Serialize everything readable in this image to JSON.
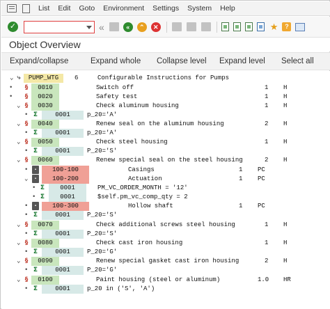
{
  "menu": {
    "items": [
      "List",
      "Edit",
      "Goto",
      "Environment",
      "Settings",
      "System",
      "Help"
    ]
  },
  "toolbar": {
    "command_field_value": ""
  },
  "title": "Object Overview",
  "app_toolbar": {
    "expand_collapse": "Expand/collapse",
    "expand_whole": "Expand whole",
    "collapse_level": "Collapse level",
    "expand_level": "Expand level",
    "select_all": "Select all"
  },
  "colors": {
    "green_cell": "#c9e6bd",
    "teal_cell": "#d7e9e7",
    "red_cell": "#f0a096",
    "root_cell": "#f4e8a6"
  },
  "tree": {
    "root": {
      "code": "PUMP_WTG",
      "number": "6",
      "description": "Configurable Instructions for Pumps"
    },
    "rows": [
      {
        "code": "0010",
        "text": "Switch off",
        "qty": "1",
        "unit": "H"
      },
      {
        "code": "0020",
        "text": "Safety test",
        "qty": "1",
        "unit": "H"
      },
      {
        "code": "0030",
        "text": "Check aluminum housing",
        "qty": "1",
        "unit": "H"
      },
      {
        "code": "0001",
        "text": "p_20='A'",
        "qty": "",
        "unit": ""
      },
      {
        "code": "0040",
        "text": "Renew seal on the aluminum housing",
        "qty": "2",
        "unit": "H"
      },
      {
        "code": "0001",
        "text": "p_20='A'",
        "qty": "",
        "unit": ""
      },
      {
        "code": "0050",
        "text": "Check steel housing",
        "qty": "1",
        "unit": "H"
      },
      {
        "code": "0001",
        "text": "P_20='S'",
        "qty": "",
        "unit": ""
      },
      {
        "code": "0060",
        "text": "Renew special seal on the steel housing",
        "qty": "2",
        "unit": "H"
      },
      {
        "code": "100-100",
        "text": "Casings",
        "qty": "1",
        "unit": "PC"
      },
      {
        "code": "100-200",
        "text": "Actuation",
        "qty": "1",
        "unit": "PC"
      },
      {
        "code": "0001",
        "text": "PM_VC_ORDER_MONTH = '12'",
        "qty": "",
        "unit": ""
      },
      {
        "code": "0001",
        "text": "$self.pm_vc_comp_qty = 2",
        "qty": "",
        "unit": ""
      },
      {
        "code": "100-300",
        "text": "Hollow shaft",
        "qty": "1",
        "unit": "PC"
      },
      {
        "code": "0001",
        "text": "P_20='S'",
        "qty": "",
        "unit": ""
      },
      {
        "code": "0070",
        "text": "Check additional screws steel housing",
        "qty": "1",
        "unit": "H"
      },
      {
        "code": "0001",
        "text": "P_20='S'",
        "qty": "",
        "unit": ""
      },
      {
        "code": "0080",
        "text": "Check cast iron housing",
        "qty": "1",
        "unit": "H"
      },
      {
        "code": "0001",
        "text": "P_20='G'",
        "qty": "",
        "unit": ""
      },
      {
        "code": "0090",
        "text": "Renew special gasket cast iron housing",
        "qty": "2",
        "unit": "H"
      },
      {
        "code": "0001",
        "text": "P_20='G'",
        "qty": "",
        "unit": ""
      },
      {
        "code": "0100",
        "text": "Paint housing (steel or aluminum)",
        "qty": "1.0",
        "unit": "HR"
      },
      {
        "code": "0001",
        "text": "p_20 in ('S', 'A')",
        "qty": "",
        "unit": ""
      }
    ]
  }
}
